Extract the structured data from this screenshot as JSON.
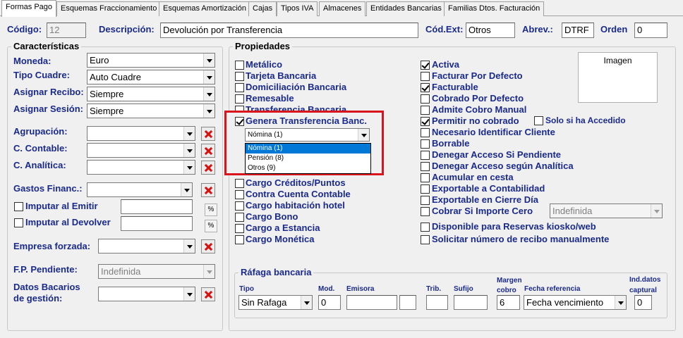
{
  "tabs": [
    "Formas Pago",
    "Esquemas Fraccionamiento",
    "Esquemas Amortización",
    "Cajas",
    "Tipos IVA",
    "Almacenes",
    "Entidades Bancarias",
    "Familias Dtos. Facturación"
  ],
  "header": {
    "codigo_label": "Código:",
    "codigo_value": "12",
    "descripcion_label": "Descripción:",
    "descripcion_value": "Devolución por Transferencia",
    "codext_label": "Cód.Ext:",
    "codext_value": "Otros",
    "abrev_label": "Abrev.:",
    "abrev_value": "DTRF",
    "orden_label": "Orden",
    "orden_value": "0"
  },
  "caracteristicas": {
    "title": "Características",
    "moneda_label": "Moneda:",
    "moneda_value": "Euro",
    "tipo_cuadre_label": "Tipo Cuadre:",
    "tipo_cuadre_value": "Auto Cuadre",
    "asignar_recibo_label": "Asignar Recibo:",
    "asignar_recibo_value": "Siempre",
    "asignar_sesion_label": "Asignar Sesión:",
    "asignar_sesion_value": "Siempre",
    "agrupacion_label": "Agrupación:",
    "c_contable_label": "C. Contable:",
    "c_analitica_label": "C. Analítica:",
    "gastos_label": "Gastos Financ.:",
    "imputar_emitir_label": "Imputar al Emitir",
    "imputar_devolver_label": "Imputar al Devolver",
    "percent_symbol": "%",
    "empresa_label": "Empresa forzada:",
    "fp_pendiente_label": "F.P. Pendiente:",
    "fp_pendiente_value": "Indefinida",
    "datos_bancarios_label_1": "Datos Bacarios",
    "datos_bancarios_label_2": "de gestión:"
  },
  "propiedades": {
    "title": "Propiedades",
    "imagen_label": "Imagen",
    "left_checks": [
      {
        "label": "Metálico",
        "checked": false
      },
      {
        "label": "Tarjeta Bancaria",
        "checked": false
      },
      {
        "label": "Domiciliación Bancaria",
        "checked": false
      },
      {
        "label": "Remesable",
        "checked": false
      },
      {
        "label": "Transferencia Bancaria",
        "checked": false
      },
      {
        "label": "Genera Transferencia Banc.",
        "checked": true
      }
    ],
    "left_checks_bottom": [
      {
        "label": "Cargo Créditos/Puntos",
        "checked": false
      },
      {
        "label": "Contra Cuenta Contable",
        "checked": false
      },
      {
        "label": "Cargo habitación hotel",
        "checked": false
      },
      {
        "label": "Cargo Bono",
        "checked": false
      },
      {
        "label": "Cargo a Estancia",
        "checked": false
      },
      {
        "label": "Cargo Monética",
        "checked": false
      }
    ],
    "transfer_select_value": "Nómina (1)",
    "transfer_options": [
      "Nómina (1)",
      "Pensión (8)",
      "Otros (9)"
    ],
    "right_checks": [
      {
        "label": "Activa",
        "checked": true
      },
      {
        "label": "Facturar Por Defecto",
        "checked": false
      },
      {
        "label": "Facturable",
        "checked": true
      },
      {
        "label": "Cobrado Por Defecto",
        "checked": false
      },
      {
        "label": "Admite Cobro Manual",
        "checked": false
      },
      {
        "label": "Permitir no cobrado",
        "checked": true
      },
      {
        "label": "Necesario Identificar Cliente",
        "checked": false
      },
      {
        "label": "Borrable",
        "checked": false
      },
      {
        "label": "Denegar Acceso Si Pendiente",
        "checked": false
      },
      {
        "label": "Denegar Acceso según Analítica",
        "checked": false
      },
      {
        "label": "Acumular en cesta",
        "checked": false
      },
      {
        "label": "Exportable a Contabilidad",
        "checked": false
      },
      {
        "label": "Exportable en Cierre Día",
        "checked": false
      },
      {
        "label": "Cobrar Si Importe Cero",
        "checked": false
      },
      {
        "label": "Disponible para Reservas kiosko/web",
        "checked": false
      },
      {
        "label": "Solicitar número de recibo manualmente",
        "checked": false
      }
    ],
    "solo_accedido_label": "Solo si ha Accedido",
    "cobrar_cero_value": "Indefinida"
  },
  "rafaga": {
    "title": "Ráfaga bancaria",
    "tipo_label": "Tipo",
    "tipo_value": "Sin Rafaga",
    "mod_label": "Mod.",
    "mod_value": "0",
    "emisora_label": "Emisora",
    "trib_label": "Trib.",
    "sufijo_label": "Sufijo",
    "margen_label_1": "Margen",
    "margen_label_2": "cobro",
    "margen_value": "6",
    "fecha_ref_label": "Fecha referencia",
    "fecha_ref_value": "Fecha vencimiento",
    "ind_label_1": "Ind.datos",
    "ind_label_2": "captural",
    "ind_value": "0"
  },
  "colors": {
    "label_blue": "#1a2a8c",
    "highlight_red": "#d9141c",
    "selection_blue": "#0078d7"
  }
}
